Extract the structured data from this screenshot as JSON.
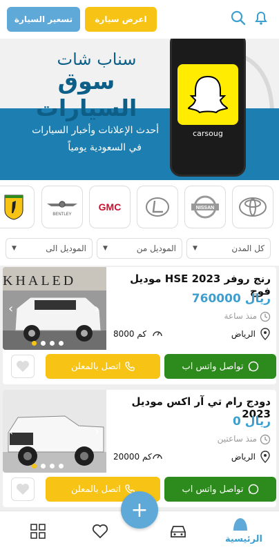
{
  "header": {
    "price_button": "تسعير السيارة",
    "offer_button": "اعرض سيارة"
  },
  "banner": {
    "title_small": "سناب شات",
    "title_big": "سوق السيارات",
    "subtitle_1": "أحدث الإعلانات وأخبار السيارات",
    "subtitle_2": "في السعودية يومياً",
    "snap_handle": "carsoug"
  },
  "brands": [
    {
      "name": "Ferrari",
      "icon": "ferrari-logo"
    },
    {
      "name": "BENTLEY",
      "icon": "bentley-logo"
    },
    {
      "name": "GMC",
      "icon": "gmc-logo"
    },
    {
      "name": "Lexus",
      "icon": "lexus-logo"
    },
    {
      "name": "NISSAN",
      "icon": "nissan-logo"
    },
    {
      "name": "Toyota",
      "icon": "toyota-logo"
    }
  ],
  "filters": {
    "city": "كل المدن",
    "model_from": "الموديل من",
    "model_to": "الموديل الى"
  },
  "listings": [
    {
      "title": "موديل HSE 2023 رنج روفر فوج",
      "price": "760000 ريال",
      "time": "منذ ساعة",
      "city": "الرياض",
      "km": "8000 كم",
      "whatsapp": "تواصل واتس اب",
      "call": "اتصل بالمعلن",
      "watermark": "KHALED"
    },
    {
      "title": "دودج رام تي آر اكس موديل 2023",
      "price": "0 ريال",
      "time": "منذ ساعتين",
      "city": "الرياض",
      "km": "20000 كم",
      "whatsapp": "تواصل واتس اب",
      "call": "اتصل بالمعلن"
    }
  ],
  "nav": {
    "home": "الرئيسية"
  },
  "colors": {
    "accent_blue": "#5ea9d8",
    "accent_yellow": "#f7c315",
    "whatsapp_green": "#2d8a1c",
    "price_blue": "#3c9fcf"
  }
}
